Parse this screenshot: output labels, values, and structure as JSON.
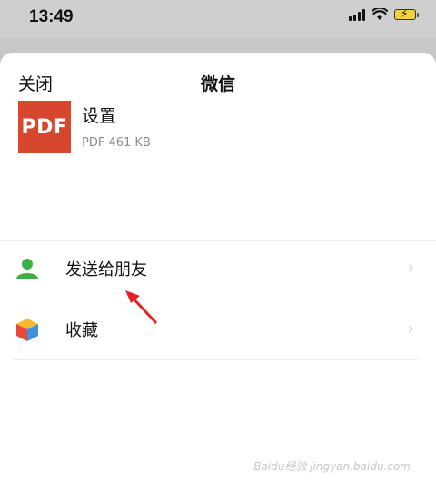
{
  "status_bar": {
    "time": "13:49"
  },
  "sheet": {
    "close_label": "关闭",
    "title": "微信"
  },
  "file": {
    "icon_text": "PDF",
    "name": "设置",
    "meta": "PDF 461 KB"
  },
  "actions": [
    {
      "label": "发送给朋友",
      "icon": "person-icon"
    },
    {
      "label": "收藏",
      "icon": "cube-icon"
    }
  ],
  "watermark": "Baidu经验 jingyan.baidu.com",
  "colors": {
    "pdf": "#d7462f",
    "person": "#3cb043",
    "arrow": "#e3222a"
  }
}
